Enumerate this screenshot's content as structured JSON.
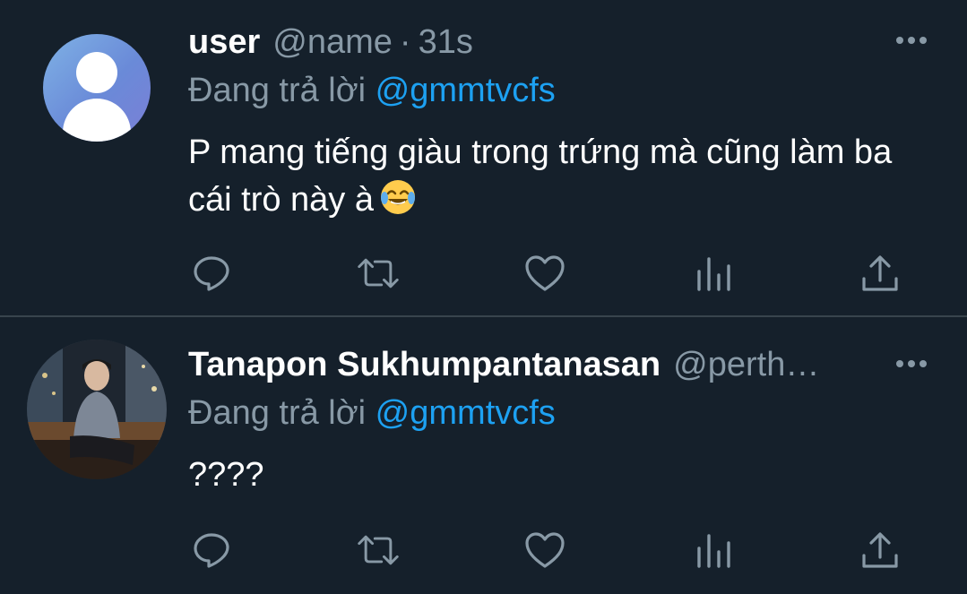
{
  "tweets": [
    {
      "display_name": "user",
      "handle": "@name",
      "separator": "·",
      "time": "31s",
      "reply_prefix": "Đang trả lời",
      "reply_to": "@gmmtvcfs",
      "text": "P mang tiếng giàu trong trứng mà cũng làm ba cái trò này à",
      "emoji": "face-with-tears-of-joy",
      "avatar": "default-avatar"
    },
    {
      "display_name": "Tanapon Sukhumpantanasan",
      "handle": "@perth…",
      "reply_prefix": "Đang trả lời",
      "reply_to": "@gmmtvcfs",
      "text": "????",
      "avatar": "profile-photo"
    }
  ],
  "action_icons": [
    "reply-icon",
    "retweet-icon",
    "like-icon",
    "analytics-icon",
    "share-icon"
  ],
  "colors": {
    "background": "#15202b",
    "divider": "#38444d",
    "secondary_text": "#8899a6",
    "accent": "#1da1f2",
    "icon": "#8899a6"
  }
}
